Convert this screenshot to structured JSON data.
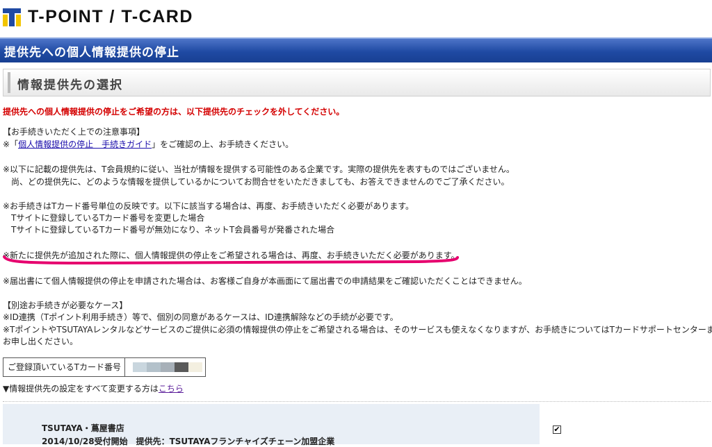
{
  "header": {
    "logo_text": "T-POINT / T-CARD",
    "page_title": "提供先への個人情報提供の停止",
    "section_title": "情報提供先の選択"
  },
  "colors": {
    "brand_blue": "#1f4aa3",
    "brand_yellow": "#f2c500",
    "alert_red": "#d40000",
    "highlight_pink": "#e6006e",
    "row_bg": "#e9eff6"
  },
  "content": {
    "alert": "提供先への個人情報提供の停止をご希望の方は、以下提供先のチェックを外してください。",
    "notice_heading": "【お手続きいただく上での注意事項】",
    "guide_prefix": "※「",
    "guide_link": "個人情報提供の停止　手続きガイド",
    "guide_suffix": "」をご確認の上、お手続きください。",
    "p1_line1": "※以下に記載の提供先は、T会員規約に従い、当社が情報を提供する可能性のある企業です。実際の提供先を表すものではございません。",
    "p1_line2": "　尚、どの提供先に、どのような情報を提供しているかについてお問合せをいただきましても、お答えできませんのでご了承ください。",
    "p2_line1": "※お手続きはTカード番号単位の反映です。以下に該当する場合は、再度、お手続きいただく必要があります。",
    "p2_line2": "　Tサイトに登録しているTカード番号を変更した場合",
    "p2_line3": "　Tサイトに登録しているTカード番号が無効になり、ネットT会員番号が発番された場合",
    "p3": "※新たに提供先が追加された際に、個人情報提供の停止をご希望される場合は、再度、お手続きいただく必要があります。",
    "p4": "※届出書にて個人情報提供の停止を申請された場合は、お客様ご自身が本画面にて届出書での申請結果をご確認いただくことはできません。",
    "special_heading": "【別途お手続きが必要なケース】",
    "special_line1": "※ID連携（Tポイント利用手続き）等で、個別の同意があるケースは、ID連携解除などの手続が必要です。",
    "special_line2": "※TポイントやTSUTAYAレンタルなどサービスのご提供に必須の情報提供の停止をご希望される場合は、そのサービスも使えなくなりますが、お手続きについてはTカードサポートセンターまで",
    "special_line3": "お申し出ください。"
  },
  "card": {
    "label": "ご登録頂いているTカード番号"
  },
  "change_all": {
    "prefix": "▼情報提供先の設定をすべて変更する方は",
    "link": "こちら"
  },
  "providers": [
    {
      "name": "TSUTAYA・蔦屋書店",
      "description": "2014/10/28受付開始　提供先：TSUTAYAフランチャイズチェーン加盟企業",
      "checked": true
    }
  ]
}
